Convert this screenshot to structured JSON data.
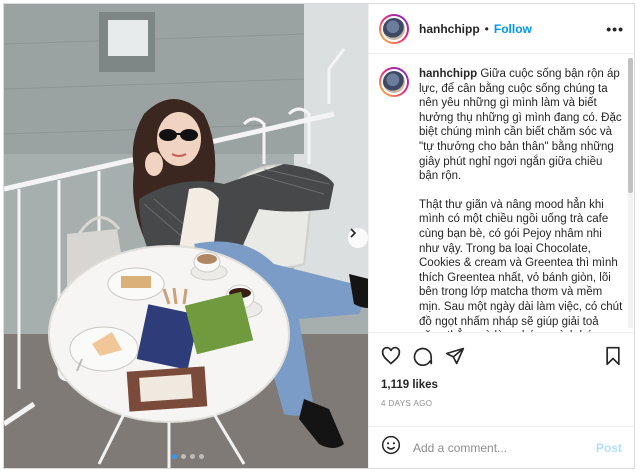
{
  "post": {
    "username": "hanhchipp",
    "separator": "•",
    "follow_label": "Follow",
    "more_label": "•••",
    "caption": {
      "username": "hanhchipp",
      "paragraph_1": "Giữa cuộc sống bận rộn áp lực, để cân bằng cuộc sống chúng ta nên yêu những gì mình làm và biết hưởng thụ những gì mình đang có. Đặc biệt chúng mình cần biết chăm sóc và \"tự thưởng cho bản thân\" bằng những giây phút nghỉ ngơi ngắn giữa chiều bận rộn.",
      "paragraph_2": "Thật thư giãn và nâng mood hẳn khi mình có một chiều ngồi uống trà cafe cùng bạn bè, có gói Pejoy nhâm nhi như vậy. Trong ba loại Chocolate, Cookies & cream và Greentea thì mình thích Greentea nhất, vỏ bánh giòn, lõi bên trong lớp matcha thơm và mềm mịn. Sau một ngày dài làm việc, có chút đồ ngọt nhấm nháp sẽ giúp giải toả căng thẳng và làm chúng mình hứng khởi hơn. Có như vậy công việc mới nhiều ý tưởng,"
    },
    "likes": "1,119 likes",
    "date": "4 DAYS AGO",
    "comment_placeholder": "Add a comment...",
    "post_label": "Post",
    "carousel": {
      "dot_count": 4,
      "active_index": 0
    }
  },
  "icons": {
    "like": "heart-icon",
    "comment": "comment-icon",
    "share": "paper-plane-icon",
    "save": "bookmark-icon",
    "emoji": "smiley-icon",
    "next": "chevron-right-icon"
  },
  "colors": {
    "accent": "#0095f6",
    "post_disabled": "#b2dffc",
    "muted": "#8e8e8e",
    "border": "#dbdbdb"
  }
}
